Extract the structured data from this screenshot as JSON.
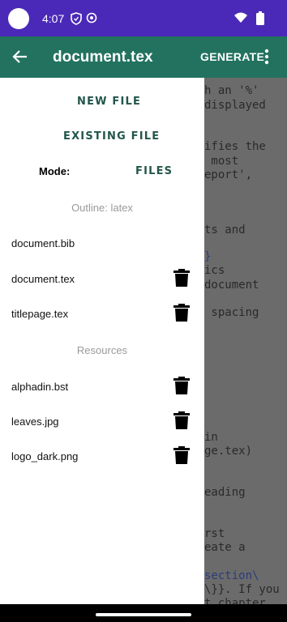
{
  "status_bar": {
    "time": "4:07",
    "icons": [
      "circle-icon",
      "shield-icon",
      "sync-icon",
      "wifi-icon",
      "battery-icon"
    ]
  },
  "app_bar": {
    "title": "document.tex",
    "generate_label": "GENERATE",
    "color": "#22725f"
  },
  "drawer": {
    "new_file_label": "NEW FILE",
    "existing_file_label": "EXISTING FILE",
    "mode_label": "Mode:",
    "mode_value": "FILES",
    "outline_header": "Outline: latex",
    "outline_items": [
      "document.bib",
      "document.tex",
      "titlepage.tex"
    ],
    "resources_header": "Resources",
    "resource_items": [
      "alphadin.bst",
      "leaves.jpg",
      "logo_dark.png"
    ]
  },
  "editor": {
    "lines": [
      "h an '%'",
      "displayed",
      "ifies the",
      " most",
      "eport',",
      "ts and",
      "}",
      "ics",
      "document",
      " spacing",
      "in",
      "ge.tex)",
      "eading",
      "rst",
      "eate a",
      "section\\",
      "\\}}. If you",
      "t chapter"
    ]
  }
}
